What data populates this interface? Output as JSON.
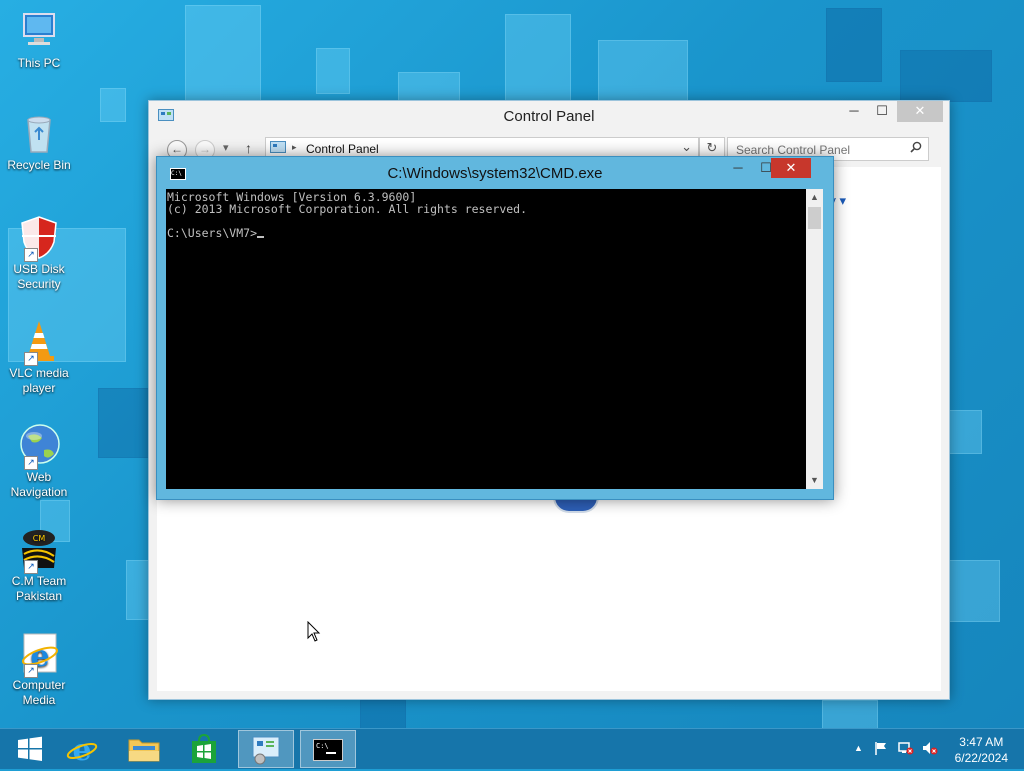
{
  "desktop": {
    "icons": [
      {
        "label": "This PC",
        "icon": "computer-icon"
      },
      {
        "label": "Recycle Bin",
        "icon": "recycle-bin-icon"
      },
      {
        "label": "USB Disk Security",
        "icon": "usb-shield-icon"
      },
      {
        "label": "VLC media player",
        "icon": "vlc-cone-icon"
      },
      {
        "label": "Web Navigation",
        "icon": "globe-icon"
      },
      {
        "label": "C.M Team Pakistan",
        "icon": "cm-team-icon"
      },
      {
        "label": "Computer Media",
        "icon": "internet-explorer-icon"
      }
    ]
  },
  "control_panel": {
    "title": "Control Panel",
    "breadcrumb": "Control Panel",
    "search_placeholder": "Search Control Panel",
    "minimize": "─",
    "maximize": "☐",
    "close": "✕",
    "back": "←",
    "forward": "→",
    "recent": "▾",
    "up": "↑",
    "refresh": "↻",
    "crumb_sep": "▸",
    "address_dropdown": "⌄",
    "category_fragment": "ry ▾",
    "category_fragment2": "y"
  },
  "cmd": {
    "title": "C:\\Windows\\system32\\CMD.exe",
    "icon_text": "C:\\",
    "lines": [
      "Microsoft Windows [Version 6.3.9600]",
      "(c) 2013 Microsoft Corporation. All rights reserved.",
      "",
      "C:\\Users\\VM7>"
    ],
    "minimize": "─",
    "maximize": "☐",
    "close": "✕",
    "scroll_up": "▲",
    "scroll_down": "▼"
  },
  "taskbar": {
    "clock_time": "3:47 AM",
    "clock_date": "6/22/2024",
    "items": [
      "start-button",
      "internet-explorer",
      "file-explorer",
      "store",
      "control-panel",
      "command-prompt"
    ],
    "active": [
      "control-panel",
      "command-prompt"
    ],
    "tray_chevron": "▲"
  },
  "colors": {
    "desktop": "#1e9ed4",
    "cmd_frame": "#61b7de",
    "close_red": "#c7372c",
    "taskbar": "#1675aa"
  }
}
